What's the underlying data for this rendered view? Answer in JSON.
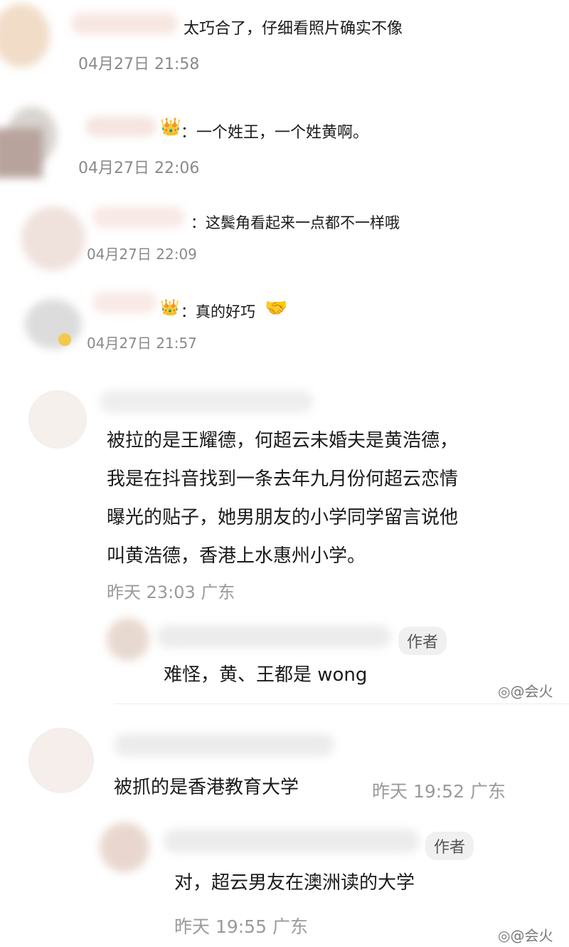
{
  "comments": [
    {
      "text": "太巧合了，仔细看照片确实不像",
      "time": "04月27日 21:58"
    },
    {
      "text": "一个姓王，一个姓黄啊。",
      "time": "04月27日 22:06",
      "icon": "crown-emoji-icon"
    },
    {
      "text": "这鬓角看起来一点都不一样哦",
      "time": "04月27日 22:09"
    },
    {
      "text": "真的好巧",
      "time": "04月27日 21:57",
      "icon": "crown-emoji-icon",
      "emoji": "🤝"
    }
  ],
  "thread1": {
    "body_lines": [
      "被拉的是王耀德，何超云未婚夫是黄浩德，",
      "我是在抖音找到一条去年九月份何超云恋情",
      "曝光的贴子，她男朋友的小学同学留言说他",
      "叫黄浩德，香港上水惠州小学。"
    ],
    "meta": "昨天 23:03 广东",
    "reply": {
      "badge": "作者",
      "text": "难怪，黄、王都是 wong"
    }
  },
  "thread2": {
    "body": "被抓的是香港教育大学",
    "meta": "昨天 19:52 广东",
    "reply": {
      "badge": "作者",
      "text": "对，超云男友在澳洲读的大学",
      "meta": "昨天 19:55 广东"
    }
  },
  "watermark": "@会火",
  "watermark_icon": "weibo-icon",
  "colors": {
    "text": "#1a1a1a",
    "meta": "#9a9a9a",
    "badge_bg": "#f0f0f0"
  }
}
